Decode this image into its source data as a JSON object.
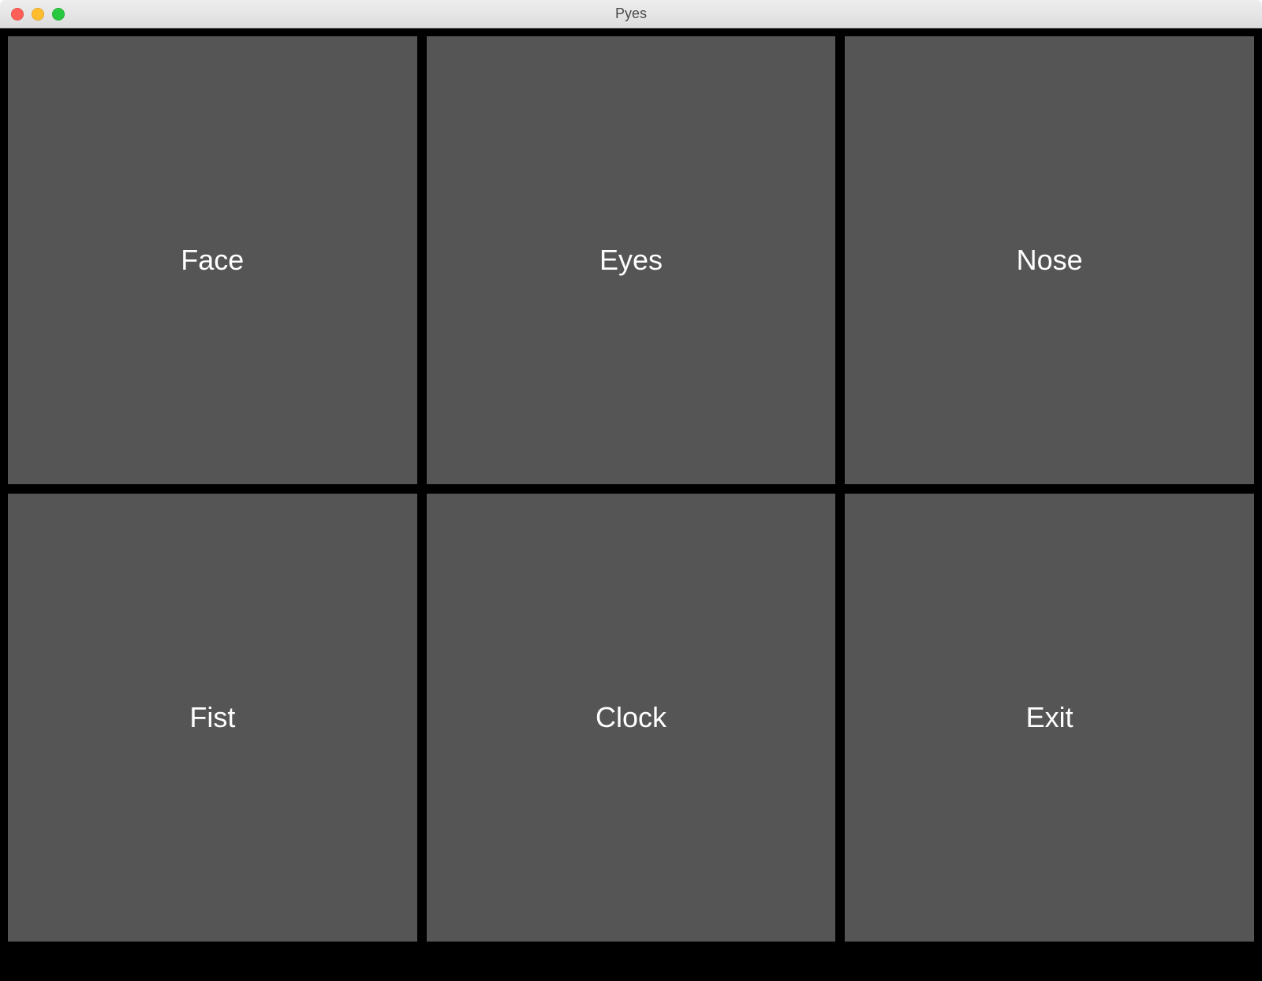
{
  "window": {
    "title": "Pyes"
  },
  "tiles": {
    "face": {
      "label": "Face"
    },
    "eyes": {
      "label": "Eyes"
    },
    "nose": {
      "label": "Nose"
    },
    "fist": {
      "label": "Fist"
    },
    "clock": {
      "label": "Clock"
    },
    "exit": {
      "label": "Exit"
    }
  },
  "colors": {
    "tile_bg": "#555555",
    "content_bg": "#000000",
    "tile_text": "#ffffff"
  }
}
